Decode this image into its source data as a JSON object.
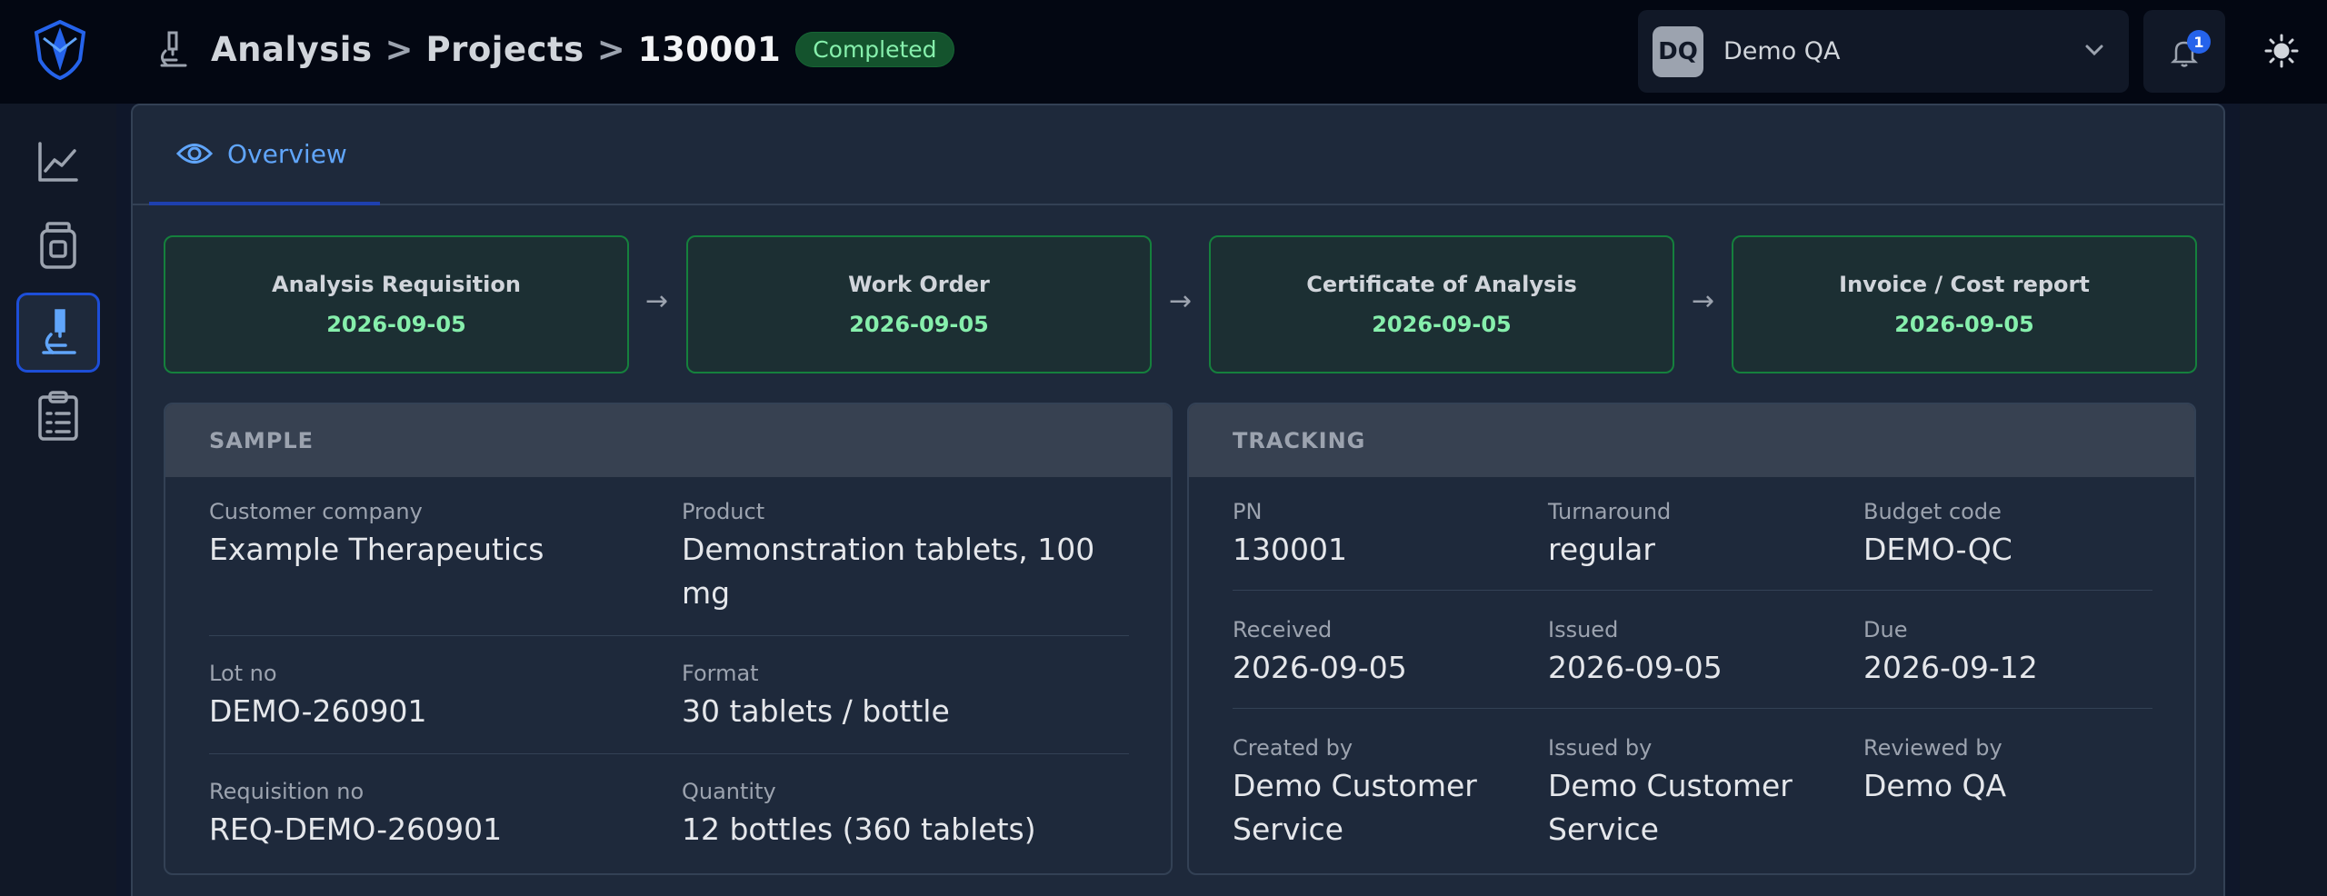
{
  "breadcrumb": {
    "items": [
      "Analysis",
      "Projects",
      "130001"
    ],
    "separator": ">",
    "status": "Completed"
  },
  "user": {
    "initials": "DQ",
    "name": "Demo QA"
  },
  "notifications": {
    "count": "1"
  },
  "sidebar": {
    "items": [
      {
        "icon": "chart-line-icon",
        "active": false
      },
      {
        "icon": "jar-icon",
        "active": false
      },
      {
        "icon": "microscope-icon",
        "active": true
      },
      {
        "icon": "clipboard-list-icon",
        "active": false
      }
    ]
  },
  "tabs": [
    {
      "label": "Overview",
      "icon": "eye-icon",
      "active": true
    }
  ],
  "workflow": {
    "arrow": "→",
    "steps": [
      {
        "title": "Analysis Requisition",
        "date": "2026-09-05"
      },
      {
        "title": "Work Order",
        "date": "2026-09-05"
      },
      {
        "title": "Certificate of Analysis",
        "date": "2026-09-05"
      },
      {
        "title": "Invoice / Cost report",
        "date": "2026-09-05"
      }
    ]
  },
  "sample": {
    "heading": "SAMPLE",
    "fields": [
      {
        "label": "Customer company",
        "value": "Example Therapeutics"
      },
      {
        "label": "Product",
        "value": "Demonstration tablets, 100 mg"
      },
      {
        "label": "Lot no",
        "value": "DEMO-260901"
      },
      {
        "label": "Format",
        "value": "30 tablets / bottle"
      },
      {
        "label": "Requisition no",
        "value": "REQ-DEMO-260901"
      },
      {
        "label": "Quantity",
        "value": "12 bottles (360 tablets)"
      }
    ]
  },
  "tracking": {
    "heading": "TRACKING",
    "fields": [
      {
        "label": "PN",
        "value": "130001"
      },
      {
        "label": "Turnaround",
        "value": "regular"
      },
      {
        "label": "Budget code",
        "value": "DEMO-QC"
      },
      {
        "label": "Received",
        "value": "2026-09-05"
      },
      {
        "label": "Issued",
        "value": "2026-09-05"
      },
      {
        "label": "Due",
        "value": "2026-09-12"
      },
      {
        "label": "Created by",
        "value": "Demo Customer Service"
      },
      {
        "label": "Issued by",
        "value": "Demo Customer Service"
      },
      {
        "label": "Reviewed by",
        "value": "Demo QA"
      }
    ]
  },
  "colors": {
    "accent": "#60a5fa",
    "success_text": "#86efac",
    "success_border": "#15803d",
    "badge_bg": "#14532d"
  }
}
